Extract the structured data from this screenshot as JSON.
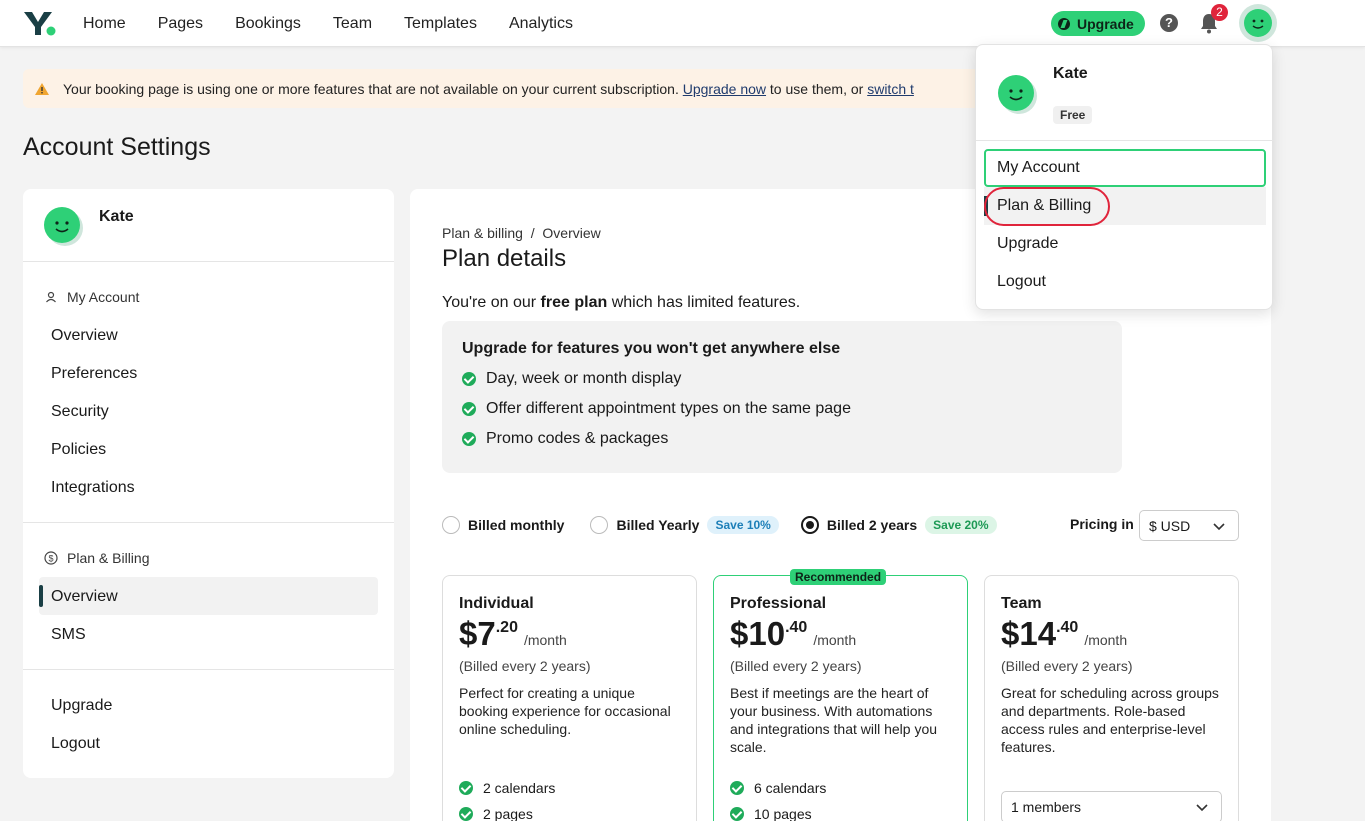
{
  "nav": {
    "items": [
      "Home",
      "Pages",
      "Bookings",
      "Team",
      "Templates",
      "Analytics"
    ],
    "upgrade_label": "Upgrade",
    "help_glyph": "?",
    "notification_count": "2"
  },
  "banner": {
    "text_before": "Your booking page is using one or more features that are not available on your current subscription.",
    "link_upgrade": "Upgrade now",
    "text_middle": "to use them, or",
    "link_switch": "switch t"
  },
  "page_title": "Account Settings",
  "sidebar": {
    "user_name": "Kate",
    "section_account": "My Account",
    "account_items": [
      "Overview",
      "Preferences",
      "Security",
      "Policies",
      "Integrations"
    ],
    "section_billing": "Plan & Billing",
    "billing_items": [
      "Overview",
      "SMS"
    ],
    "bottom_items": [
      "Upgrade",
      "Logout"
    ]
  },
  "main": {
    "breadcrumb_parent": "Plan & billing",
    "breadcrumb_sep": "/",
    "breadcrumb_current": "Overview",
    "title": "Plan details",
    "free_prefix": "You're on our",
    "free_bold": "free plan",
    "free_suffix": "which has limited features.",
    "features_title": "Upgrade for features you won't get anywhere else",
    "features": [
      "Day, week or month display",
      "Offer different appointment types on the same page",
      "Promo codes & packages"
    ],
    "billing_options": [
      {
        "label": "Billed monthly",
        "badge": "",
        "selected": false
      },
      {
        "label": "Billed Yearly",
        "badge": "Save 10%",
        "selected": false
      },
      {
        "label": "Billed 2 years",
        "badge": "Save 20%",
        "selected": true
      }
    ],
    "pricing_label": "Pricing in",
    "currency": "$ USD",
    "plans": [
      {
        "name": "Individual",
        "dollars": "$7",
        "cents": ".20",
        "per": "/month",
        "billed": "(Billed every 2 years)",
        "desc": "Perfect for creating a unique booking experience for occasional online scheduling.",
        "features": [
          "2 calendars",
          "2 pages"
        ]
      },
      {
        "name": "Professional",
        "badge": "Recommended",
        "dollars": "$10",
        "cents": ".40",
        "per": "/month",
        "billed": "(Billed every 2 years)",
        "desc": "Best if meetings are the heart of your business. With automations and integrations that will help you scale.",
        "features": [
          "6 calendars",
          "10 pages"
        ]
      },
      {
        "name": "Team",
        "dollars": "$14",
        "cents": ".40",
        "per": "/month",
        "billed": "(Billed every 2 years)",
        "desc": "Great for scheduling across groups and departments. Role-based access rules and enterprise-level features.",
        "members": "1 members"
      }
    ]
  },
  "dropdown": {
    "user_name": "Kate",
    "plan_badge": "Free",
    "items": [
      "My Account",
      "Plan & Billing",
      "Upgrade",
      "Logout"
    ]
  },
  "colors": {
    "accent_green": "#2ed077",
    "check_green": "#1fab5a",
    "badge_red": "#e0243b",
    "banner_bg": "#fdf2e6",
    "active_bar": "#1a3f45"
  }
}
